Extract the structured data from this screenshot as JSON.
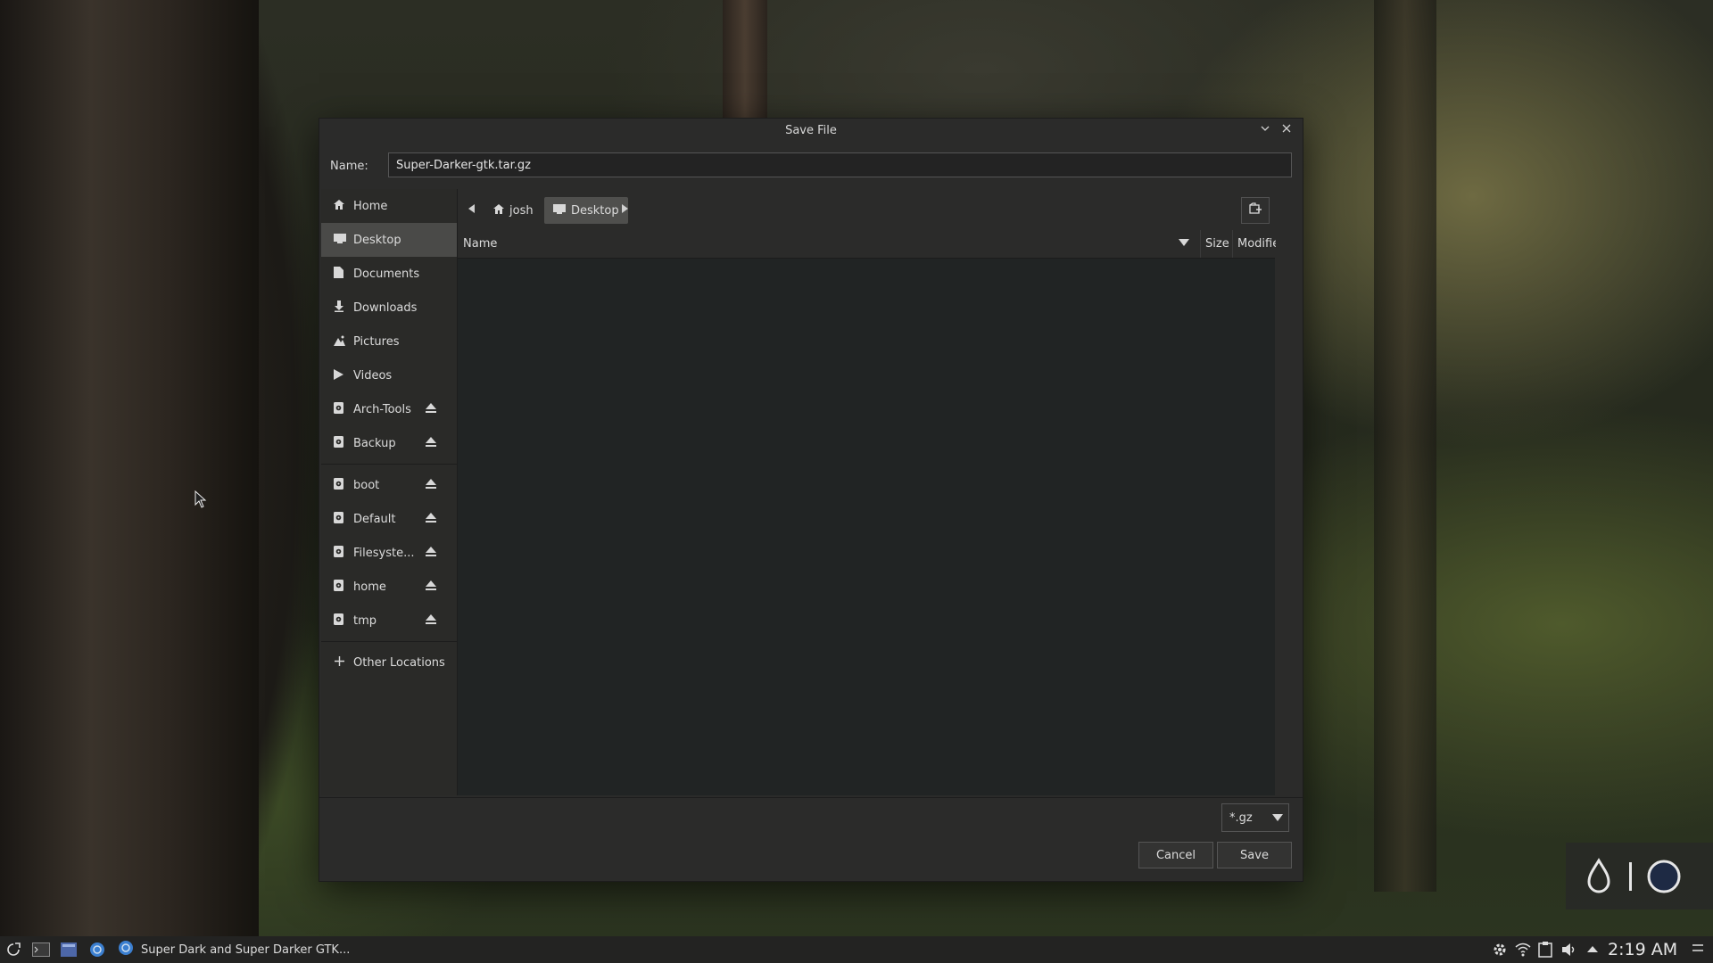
{
  "dialog": {
    "title": "Save File",
    "name_label": "Name:",
    "name_value": "Super-Darker-gtk.tar.gz",
    "pathbar": {
      "crumbs": [
        {
          "label": "josh",
          "icon": "home-icon"
        },
        {
          "label": "Desktop",
          "icon": "desktop-icon",
          "active": true
        }
      ]
    },
    "columns": {
      "name": "Name",
      "size": "Size",
      "modified": "Modified"
    },
    "filter": {
      "selected": "*.gz"
    },
    "buttons": {
      "cancel": "Cancel",
      "save": "Save"
    }
  },
  "sidebar": {
    "places": [
      {
        "label": "Home",
        "icon": "home-icon"
      },
      {
        "label": "Desktop",
        "icon": "desktop-icon",
        "selected": true
      },
      {
        "label": "Documents",
        "icon": "document-icon"
      },
      {
        "label": "Downloads",
        "icon": "download-icon"
      },
      {
        "label": "Pictures",
        "icon": "pictures-icon"
      },
      {
        "label": "Videos",
        "icon": "video-icon"
      },
      {
        "label": "Arch-Tools",
        "icon": "drive-icon",
        "eject": true
      },
      {
        "label": "Backup",
        "icon": "drive-icon",
        "eject": true
      }
    ],
    "devices": [
      {
        "label": "boot",
        "icon": "drive-icon",
        "eject": true
      },
      {
        "label": "Default",
        "icon": "drive-icon",
        "eject": true
      },
      {
        "label": "Filesyste...",
        "icon": "drive-icon",
        "eject": true
      },
      {
        "label": "home",
        "icon": "drive-icon",
        "eject": true
      },
      {
        "label": "tmp",
        "icon": "drive-icon",
        "eject": true
      }
    ],
    "other": {
      "label": "Other Locations",
      "icon": "plus-icon"
    }
  },
  "taskbar": {
    "window_title": "Super Dark and Super Darker GTK...",
    "clock": "2:19 AM"
  }
}
